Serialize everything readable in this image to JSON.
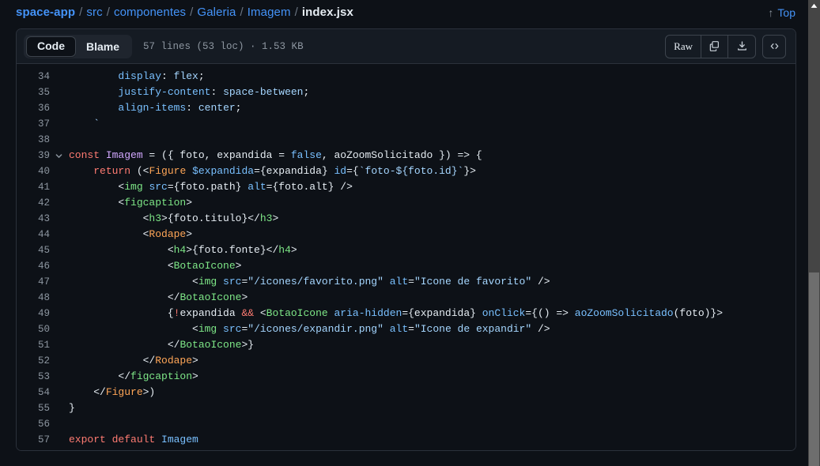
{
  "header": {
    "breadcrumb": {
      "parts": [
        {
          "label": "space-app",
          "type": "root"
        },
        {
          "label": "src",
          "type": "link"
        },
        {
          "label": "componentes",
          "type": "link"
        },
        {
          "label": "Galeria",
          "type": "link"
        },
        {
          "label": "Imagem",
          "type": "link"
        },
        {
          "label": "index.jsx",
          "type": "current"
        }
      ],
      "separator": "/"
    },
    "top_link": {
      "label": "Top",
      "arrow": "↑",
      "icon": "arrow-up-icon"
    }
  },
  "toolbar": {
    "view_toggle": {
      "code_label": "Code",
      "blame_label": "Blame",
      "active": "Code"
    },
    "file_meta": "57 lines (53 loc) · 1.53 KB",
    "raw_label": "Raw",
    "copy_icon": "copy-icon",
    "download_icon": "download-icon",
    "symbols_icon": "code-brackets-icon"
  },
  "code": {
    "language": "jsx",
    "fold_icon": "chevron-down-icon",
    "lines": [
      {
        "n": "34",
        "fold": false,
        "tokens": [
          {
            "t": "        ",
            "c": "t-plain"
          },
          {
            "t": "display",
            "c": "t-css-prop"
          },
          {
            "t": ": ",
            "c": "t-plain"
          },
          {
            "t": "flex",
            "c": "t-css-val"
          },
          {
            "t": ";",
            "c": "t-plain"
          }
        ]
      },
      {
        "n": "35",
        "fold": false,
        "tokens": [
          {
            "t": "        ",
            "c": "t-plain"
          },
          {
            "t": "justify-content",
            "c": "t-css-prop"
          },
          {
            "t": ": ",
            "c": "t-plain"
          },
          {
            "t": "space-between",
            "c": "t-css-val"
          },
          {
            "t": ";",
            "c": "t-plain"
          }
        ]
      },
      {
        "n": "36",
        "fold": false,
        "tokens": [
          {
            "t": "        ",
            "c": "t-plain"
          },
          {
            "t": "align-items",
            "c": "t-css-prop"
          },
          {
            "t": ": ",
            "c": "t-plain"
          },
          {
            "t": "center",
            "c": "t-css-val"
          },
          {
            "t": ";",
            "c": "t-plain"
          }
        ]
      },
      {
        "n": "37",
        "fold": false,
        "tokens": [
          {
            "t": "    `",
            "c": "t-str"
          }
        ]
      },
      {
        "n": "38",
        "fold": false,
        "tokens": []
      },
      {
        "n": "39",
        "fold": true,
        "tokens": [
          {
            "t": "const ",
            "c": "t-kw"
          },
          {
            "t": "Imagem",
            "c": "t-fn"
          },
          {
            "t": " = ({ foto, expandida = ",
            "c": "t-plain"
          },
          {
            "t": "false",
            "c": "t-attr"
          },
          {
            "t": ", aoZoomSolicitado }) => {",
            "c": "t-plain"
          }
        ]
      },
      {
        "n": "40",
        "fold": false,
        "tokens": [
          {
            "t": "    ",
            "c": "t-plain"
          },
          {
            "t": "return",
            "c": "t-kw"
          },
          {
            "t": " (<",
            "c": "t-plain"
          },
          {
            "t": "Figure",
            "c": "t-comp"
          },
          {
            "t": " ",
            "c": "t-plain"
          },
          {
            "t": "$expandida",
            "c": "t-attr"
          },
          {
            "t": "={expandida} ",
            "c": "t-plain"
          },
          {
            "t": "id",
            "c": "t-attr"
          },
          {
            "t": "={",
            "c": "t-plain"
          },
          {
            "t": "`foto-${foto.id}`",
            "c": "t-str"
          },
          {
            "t": "}>",
            "c": "t-plain"
          }
        ]
      },
      {
        "n": "41",
        "fold": false,
        "tokens": [
          {
            "t": "        <",
            "c": "t-plain"
          },
          {
            "t": "img",
            "c": "t-tag"
          },
          {
            "t": " ",
            "c": "t-plain"
          },
          {
            "t": "src",
            "c": "t-attr"
          },
          {
            "t": "={foto.path} ",
            "c": "t-plain"
          },
          {
            "t": "alt",
            "c": "t-attr"
          },
          {
            "t": "={foto.alt} />",
            "c": "t-plain"
          }
        ]
      },
      {
        "n": "42",
        "fold": false,
        "tokens": [
          {
            "t": "        <",
            "c": "t-plain"
          },
          {
            "t": "figcaption",
            "c": "t-tag"
          },
          {
            "t": ">",
            "c": "t-plain"
          }
        ]
      },
      {
        "n": "43",
        "fold": false,
        "tokens": [
          {
            "t": "            <",
            "c": "t-plain"
          },
          {
            "t": "h3",
            "c": "t-tag"
          },
          {
            "t": ">{foto.titulo}</",
            "c": "t-plain"
          },
          {
            "t": "h3",
            "c": "t-tag"
          },
          {
            "t": ">",
            "c": "t-plain"
          }
        ]
      },
      {
        "n": "44",
        "fold": false,
        "tokens": [
          {
            "t": "            <",
            "c": "t-plain"
          },
          {
            "t": "Rodape",
            "c": "t-comp"
          },
          {
            "t": ">",
            "c": "t-plain"
          }
        ]
      },
      {
        "n": "45",
        "fold": false,
        "tokens": [
          {
            "t": "                <",
            "c": "t-plain"
          },
          {
            "t": "h4",
            "c": "t-tag"
          },
          {
            "t": ">{foto.fonte}</",
            "c": "t-plain"
          },
          {
            "t": "h4",
            "c": "t-tag"
          },
          {
            "t": ">",
            "c": "t-plain"
          }
        ]
      },
      {
        "n": "46",
        "fold": false,
        "tokens": [
          {
            "t": "                <",
            "c": "t-plain"
          },
          {
            "t": "BotaoIcone",
            "c": "t-tag"
          },
          {
            "t": ">",
            "c": "t-plain"
          }
        ]
      },
      {
        "n": "47",
        "fold": false,
        "tokens": [
          {
            "t": "                    <",
            "c": "t-plain"
          },
          {
            "t": "img",
            "c": "t-tag"
          },
          {
            "t": " ",
            "c": "t-plain"
          },
          {
            "t": "src",
            "c": "t-attr"
          },
          {
            "t": "=",
            "c": "t-plain"
          },
          {
            "t": "\"/icones/favorito.png\"",
            "c": "t-str"
          },
          {
            "t": " ",
            "c": "t-plain"
          },
          {
            "t": "alt",
            "c": "t-attr"
          },
          {
            "t": "=",
            "c": "t-plain"
          },
          {
            "t": "\"Icone de favorito\"",
            "c": "t-str"
          },
          {
            "t": " />",
            "c": "t-plain"
          }
        ]
      },
      {
        "n": "48",
        "fold": false,
        "tokens": [
          {
            "t": "                </",
            "c": "t-plain"
          },
          {
            "t": "BotaoIcone",
            "c": "t-tag"
          },
          {
            "t": ">",
            "c": "t-plain"
          }
        ]
      },
      {
        "n": "49",
        "fold": false,
        "tokens": [
          {
            "t": "                {",
            "c": "t-plain"
          },
          {
            "t": "!",
            "c": "t-kw"
          },
          {
            "t": "expandida ",
            "c": "t-plain"
          },
          {
            "t": "&&",
            "c": "t-kw"
          },
          {
            "t": " <",
            "c": "t-plain"
          },
          {
            "t": "BotaoIcone",
            "c": "t-tag"
          },
          {
            "t": " ",
            "c": "t-plain"
          },
          {
            "t": "aria-hidden",
            "c": "t-attr"
          },
          {
            "t": "={expandida} ",
            "c": "t-plain"
          },
          {
            "t": "onClick",
            "c": "t-attr"
          },
          {
            "t": "={() => ",
            "c": "t-plain"
          },
          {
            "t": "aoZoomSolicitado",
            "c": "t-attr"
          },
          {
            "t": "(foto)}>",
            "c": "t-plain"
          }
        ]
      },
      {
        "n": "50",
        "fold": false,
        "tokens": [
          {
            "t": "                    <",
            "c": "t-plain"
          },
          {
            "t": "img",
            "c": "t-tag"
          },
          {
            "t": " ",
            "c": "t-plain"
          },
          {
            "t": "src",
            "c": "t-attr"
          },
          {
            "t": "=",
            "c": "t-plain"
          },
          {
            "t": "\"/icones/expandir.png\"",
            "c": "t-str"
          },
          {
            "t": " ",
            "c": "t-plain"
          },
          {
            "t": "alt",
            "c": "t-attr"
          },
          {
            "t": "=",
            "c": "t-plain"
          },
          {
            "t": "\"Icone de expandir\"",
            "c": "t-str"
          },
          {
            "t": " />",
            "c": "t-plain"
          }
        ]
      },
      {
        "n": "51",
        "fold": false,
        "tokens": [
          {
            "t": "                </",
            "c": "t-plain"
          },
          {
            "t": "BotaoIcone",
            "c": "t-tag"
          },
          {
            "t": ">}",
            "c": "t-plain"
          }
        ]
      },
      {
        "n": "52",
        "fold": false,
        "tokens": [
          {
            "t": "            </",
            "c": "t-plain"
          },
          {
            "t": "Rodape",
            "c": "t-comp"
          },
          {
            "t": ">",
            "c": "t-plain"
          }
        ]
      },
      {
        "n": "53",
        "fold": false,
        "tokens": [
          {
            "t": "        </",
            "c": "t-plain"
          },
          {
            "t": "figcaption",
            "c": "t-tag"
          },
          {
            "t": ">",
            "c": "t-plain"
          }
        ]
      },
      {
        "n": "54",
        "fold": false,
        "tokens": [
          {
            "t": "    </",
            "c": "t-plain"
          },
          {
            "t": "Figure",
            "c": "t-comp"
          },
          {
            "t": ">)",
            "c": "t-plain"
          }
        ]
      },
      {
        "n": "55",
        "fold": false,
        "tokens": [
          {
            "t": "}",
            "c": "t-plain"
          }
        ]
      },
      {
        "n": "56",
        "fold": false,
        "tokens": []
      },
      {
        "n": "57",
        "fold": false,
        "tokens": [
          {
            "t": "export ",
            "c": "t-kw"
          },
          {
            "t": "default",
            "c": "t-kw"
          },
          {
            "t": " ",
            "c": "t-plain"
          },
          {
            "t": "Imagem",
            "c": "t-attr"
          }
        ]
      }
    ]
  },
  "scrollbar": {
    "up_arrow_icon": "scroll-up-arrow-icon",
    "thumb": "scrollbar-thumb"
  },
  "colors": {
    "page_bg": "#0d1117",
    "panel_border": "#2b313b",
    "toolbar_bg": "#151b23",
    "link": "#4493f8",
    "muted": "#8d96a0"
  }
}
